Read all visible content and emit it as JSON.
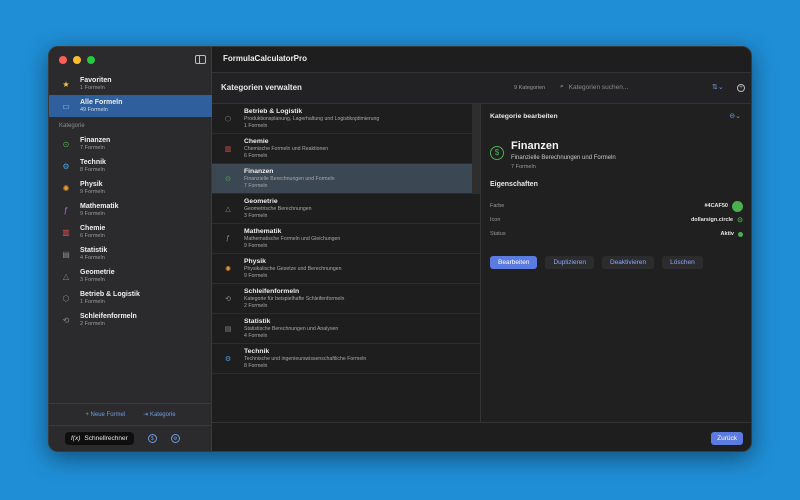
{
  "app": {
    "title": "FormulaCalculatorPro"
  },
  "colors": {
    "accent": "#5b7be0",
    "selected_sidebar": "#2f5f9c",
    "finance_green": "#4CAF50"
  },
  "sidebar": {
    "top_items": [
      {
        "icon": "star-icon",
        "label": "Favoriten",
        "count": "1 Formeln"
      },
      {
        "icon": "folder-icon",
        "label": "Alle Formeln",
        "count": "49 Formeln"
      }
    ],
    "section_label": "Kategorie",
    "categories": [
      {
        "icon": "dollar-icon",
        "label": "Finanzen",
        "count": "7 Formeln"
      },
      {
        "icon": "gear-icon",
        "label": "Technik",
        "count": "8 Formeln"
      },
      {
        "icon": "atom-icon",
        "label": "Physik",
        "count": "9 Formeln"
      },
      {
        "icon": "function-icon",
        "label": "Mathematik",
        "count": "9 Formeln"
      },
      {
        "icon": "flask-icon",
        "label": "Chemie",
        "count": "6 Formeln"
      },
      {
        "icon": "chart-icon",
        "label": "Statistik",
        "count": "4 Formeln"
      },
      {
        "icon": "triangle-icon",
        "label": "Geometrie",
        "count": "3 Formeln"
      },
      {
        "icon": "box-icon",
        "label": "Betrieb & Logistik",
        "count": "1 Formeln"
      },
      {
        "icon": "loop-icon",
        "label": "Schleifenformeln",
        "count": "2 Formeln"
      }
    ],
    "new_formula": "Neue Formel",
    "new_category": "Kategorie",
    "quick_calc": "Schnellrechner",
    "quick_calc_icon": "f(x)"
  },
  "toolbar": {
    "title": "Kategorien verwalten",
    "count": "9 Kategorien",
    "search_placeholder": "Kategorien suchen..."
  },
  "category_list": [
    {
      "icon": "box-icon",
      "name": "Betrieb & Logistik",
      "desc": "Produktionsplanung, Lagerhaltung und Logistikoptimierung",
      "count": "1 Formeln"
    },
    {
      "icon": "flask-icon",
      "name": "Chemie",
      "desc": "Chemische Formeln und Reaktionen",
      "count": "6 Formeln"
    },
    {
      "icon": "dollar-icon",
      "name": "Finanzen",
      "desc": "Finanzielle Berechnungen und Formeln",
      "count": "7 Formeln"
    },
    {
      "icon": "triangle-icon",
      "name": "Geometrie",
      "desc": "Geometrische Berechnungen",
      "count": "3 Formeln"
    },
    {
      "icon": "function-icon",
      "name": "Mathematik",
      "desc": "Mathematische Formeln und Gleichungen",
      "count": "9 Formeln"
    },
    {
      "icon": "atom-icon",
      "name": "Physik",
      "desc": "Physikalische Gesetze und Berechnungen",
      "count": "9 Formeln"
    },
    {
      "icon": "loop-icon",
      "name": "Schleifenformeln",
      "desc": "Kategorie für beispielhafte Schleifenformeln",
      "count": "2 Formeln"
    },
    {
      "icon": "chart-icon",
      "name": "Statistik",
      "desc": "Statistische Berechnungen und Analysen",
      "count": "4 Formeln"
    },
    {
      "icon": "gear-icon",
      "name": "Technik",
      "desc": "Technische und ingenieurswissenschaftliche Formeln",
      "count": "8 Formeln"
    }
  ],
  "detail": {
    "title": "Kategorie bearbeiten",
    "name": "Finanzen",
    "desc": "Finanzielle Berechnungen und Formeln",
    "count": "7 Formeln",
    "props_heading": "Eigenschaften",
    "props": [
      {
        "key": "Farbe",
        "value": "#4CAF50"
      },
      {
        "key": "Icon",
        "value": "dollarsign.circle"
      },
      {
        "key": "Status",
        "value": "Aktiv"
      }
    ],
    "actions": {
      "edit": "Bearbeiten",
      "duplicate": "Duplizieren",
      "deactivate": "Deaktivieren",
      "delete": "Löschen"
    }
  },
  "footer": {
    "back": "Zurück"
  }
}
